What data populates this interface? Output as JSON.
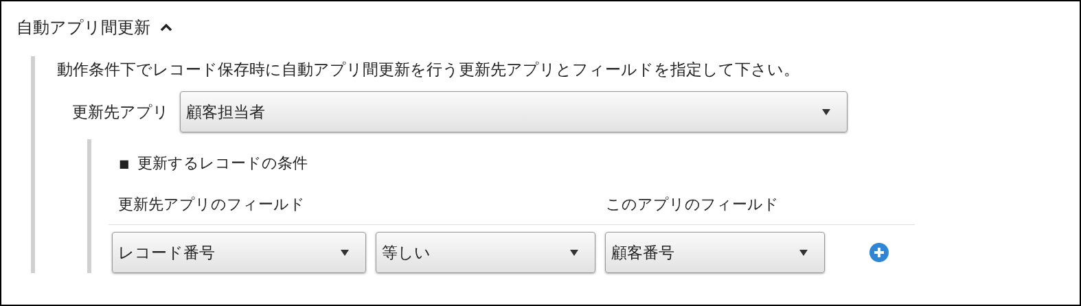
{
  "section": {
    "title": "自動アプリ間更新",
    "expanded": true
  },
  "description": "動作条件下でレコード保存時に自動アプリ間更新を行う更新先アプリとフィールドを指定して下さい。",
  "target_app": {
    "label": "更新先アプリ",
    "value": "顧客担当者"
  },
  "conditions": {
    "bullet": "■",
    "title": "更新するレコードの条件",
    "columns": [
      "更新先アプリのフィールド",
      "このアプリのフィールド"
    ],
    "rows": [
      {
        "target_field": "レコード番号",
        "operator": "等しい",
        "this_field": "顧客番号"
      }
    ]
  }
}
